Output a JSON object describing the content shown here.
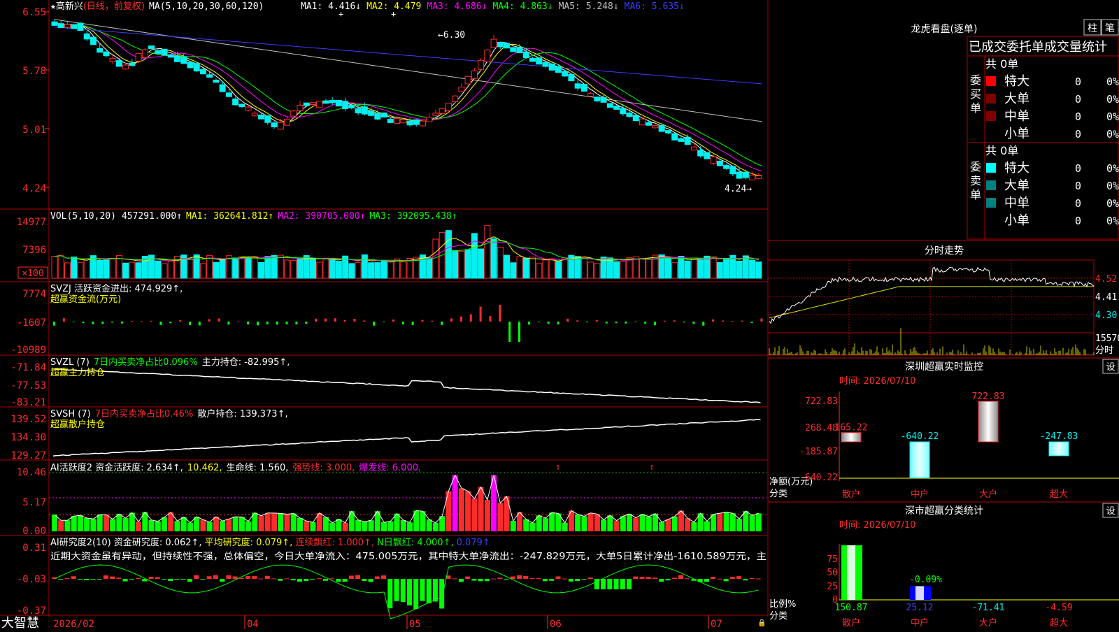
{
  "colors": {
    "up": "#ff2b2b",
    "down": "#00f0f0",
    "frame": "#b00000",
    "white": "#ffffff",
    "yellow": "#ffff00",
    "magenta": "#ff00ff",
    "green": "#00ff00",
    "gray": "#c0c0c0",
    "blue": "#3030ff",
    "bgBlack": "#000000"
  },
  "main": {
    "header": {
      "star": "★",
      "stock": "高新兴",
      "period": "(日线，前复权)",
      "ma_label": "MA(5,10,20,30,60,120)",
      "ma_items": [
        {
          "t": "MA1: 4.416↓",
          "c": "#ffffff"
        },
        {
          "t": "MA2: 4.479",
          "c": "#ffff00"
        },
        {
          "t": "MA3: 4.686↓",
          "c": "#ff00ff"
        },
        {
          "t": "MA4: 4.863↓",
          "c": "#00ff00"
        },
        {
          "t": "MA5: 5.248↓",
          "c": "#c0c0c0"
        },
        {
          "t": "MA6: 5.635↓",
          "c": "#3c3cff"
        }
      ]
    },
    "yaxis": [
      "6.55",
      "5.78",
      "5.01",
      "4.24"
    ],
    "high_label": "←6.30",
    "low_label": "4.24→",
    "bottom_left": "大智慧"
  },
  "vol": {
    "label": "VOL(5,10,20)",
    "value": "457291.000↑",
    "ma": [
      {
        "t": "MA1: 362641.812↑",
        "c": "#ffff00"
      },
      {
        "t": "MA2: 390705.000↑",
        "c": "#ff00ff"
      },
      {
        "t": "MA3: 392095.438↑",
        "c": "#00ff00"
      }
    ],
    "yaxis": [
      "14977",
      "7396",
      "×100"
    ]
  },
  "svzj": {
    "label": "SVZJ  活跃资金进出: 474.929↑,",
    "sub": "超赢资金流(万元)",
    "yaxis": [
      "7774",
      "-1607",
      "-10989"
    ]
  },
  "svzl": {
    "label": "SVZL (7)",
    "green": "7日内买卖净占比0.096%",
    "white": "主力持仓: -82.995↑,",
    "sub": "超赢主力持仓",
    "yaxis": [
      "-71.84",
      "-77.53",
      "-83.21"
    ]
  },
  "svsh": {
    "label": "SVSH (7)",
    "red": "7日内买卖净占比0.46%",
    "white": "散户持仓: 139.373↑,",
    "sub": "超赢散户持仓",
    "yaxis": [
      "139.52",
      "134.30",
      "129.27"
    ]
  },
  "ai1": {
    "items": [
      {
        "t": "AI活跃度2 资金活跃度: 2.634↑,",
        "c": "#ffffff"
      },
      {
        "t": "10.462,",
        "c": "#ffff00"
      },
      {
        "t": "生命线: 1.560,",
        "c": "#ffffff"
      },
      {
        "t": "强势线: 3.000,",
        "c": "#ff2b2b"
      },
      {
        "t": "爆发线: 6.000,",
        "c": "#ff00ff"
      }
    ],
    "yaxis": [
      "10.46",
      "5.17",
      "0.00"
    ]
  },
  "ai2": {
    "items": [
      {
        "t": "AI研究度2(10) 资金研究度: 0.062↑,",
        "c": "#ffffff"
      },
      {
        "t": "平均研究度: 0.079↑,",
        "c": "#ffff00"
      },
      {
        "t": "连续飘红: 1.000↑,",
        "c": "#ff2b2b"
      },
      {
        "t": "N日飘红: 4.000↑,",
        "c": "#00ff00"
      },
      {
        "t": "0.079↑",
        "c": "#3c3cff"
      }
    ],
    "text": "近期大资金虽有异动，但持续性不强，总体偏空，今日大单净流入：475.005万元，其中特大单净流出：-247.829万元，大单5日累计净出-1610.589万元，主",
    "yaxis": [
      "0.31",
      "-0.03",
      "-0.37"
    ]
  },
  "xaxis": {
    "labels": [
      "2026/02",
      "04",
      "05",
      "06",
      "07"
    ]
  },
  "longhu": {
    "title": "龙虎看盘(逐单)",
    "btn1": "柱",
    "btn2": "笔",
    "subtitle": "已成交委托单成交量统计",
    "buy": {
      "side": "委买单",
      "total": "共 0单",
      "rows": [
        {
          "name": "特大",
          "v": "0",
          "p": "0%",
          "c": "#ff0000"
        },
        {
          "name": "大单",
          "v": "0",
          "p": "0%",
          "c": "#800000"
        },
        {
          "name": "中单",
          "v": "0",
          "p": "0%",
          "c": "#800000"
        },
        {
          "name": "小单",
          "v": "0",
          "p": "0%",
          "c": ""
        }
      ]
    },
    "sell": {
      "side": "委卖单",
      "total": "共 0单",
      "rows": [
        {
          "name": "特大",
          "v": "0",
          "p": "0%",
          "c": "#00ffff"
        },
        {
          "name": "大单",
          "v": "0",
          "p": "0%",
          "c": "#008080"
        },
        {
          "name": "中单",
          "v": "0",
          "p": "0%",
          "c": "#008080"
        },
        {
          "name": "小单",
          "v": "0",
          "p": "0%",
          "c": ""
        }
      ]
    }
  },
  "intraday": {
    "title": "分时走势",
    "yaxis": [
      "4.52",
      "4.41",
      "4.30"
    ],
    "vol": "15570",
    "label": "分时"
  },
  "monitor": {
    "title": "深圳超赢实时监控",
    "btn": "设",
    "date": "时间: 2026/07/10",
    "yaxis": [
      "722.83",
      "268.48",
      "-185.87",
      "-640.22"
    ],
    "values": [
      {
        "label": "165.22",
        "v": 165.22,
        "c": "#ff2b2b"
      },
      {
        "label": "-640.22",
        "v": -640.22,
        "c": "#00f0f0"
      },
      {
        "label": "722.83",
        "v": 722.83,
        "c": "#ff2b2b"
      },
      {
        "label": "-247.83",
        "v": -247.83,
        "c": "#00f0f0"
      }
    ],
    "cats": [
      "散户",
      "中户",
      "大户",
      "超大"
    ],
    "left1": "净额(万元)",
    "left2": "分类"
  },
  "classify": {
    "title": "深市超赢分类统计",
    "btn": "设",
    "date": "时间: 2026/07/10",
    "yaxis": [
      "75",
      "50",
      "25",
      "0"
    ],
    "pct": "-0.09%",
    "bars": [
      {
        "cat": "散户",
        "val": "150.87",
        "h": 100,
        "c": "#00ff00",
        "bar": "#00ff00"
      },
      {
        "cat": "中户",
        "val": "25.12",
        "h": 25.12,
        "c": "#3c3cff",
        "bar": "#0000ff"
      },
      {
        "cat": "大户",
        "val": "-71.41",
        "h": 0,
        "c": "#00f0f0",
        "bar": "#00f0f0"
      },
      {
        "cat": "超大",
        "val": "-4.59",
        "h": 0,
        "c": "#ff2b2b",
        "bar": "#ff2b2b"
      }
    ],
    "left1": "比例%",
    "left2": "分类"
  }
}
